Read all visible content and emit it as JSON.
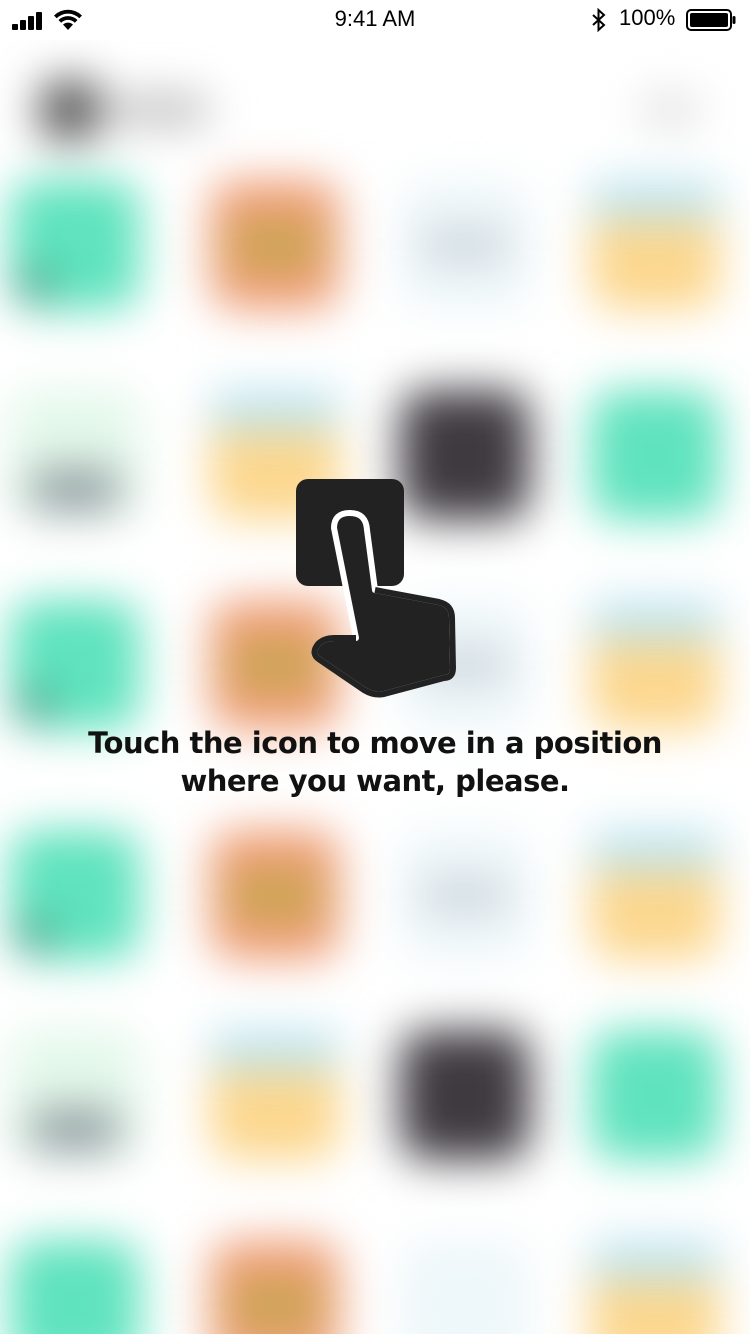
{
  "status_bar": {
    "time": "9:41 AM",
    "battery_percent": "100%",
    "icons": [
      "signal-icon",
      "wifi-icon",
      "bluetooth-icon",
      "battery-icon"
    ]
  },
  "overlay": {
    "icon": "hand-tap-icon",
    "instruction_line1": "Touch the icon to move in a position",
    "instruction_line2": "where you want, please."
  },
  "colors": {
    "tile_green": "#5fe3be",
    "tile_orange": "#f09d76",
    "tile_yellow": "#fcd78e",
    "tile_dark": "#3e3a40",
    "icon_dark": "#222222"
  }
}
